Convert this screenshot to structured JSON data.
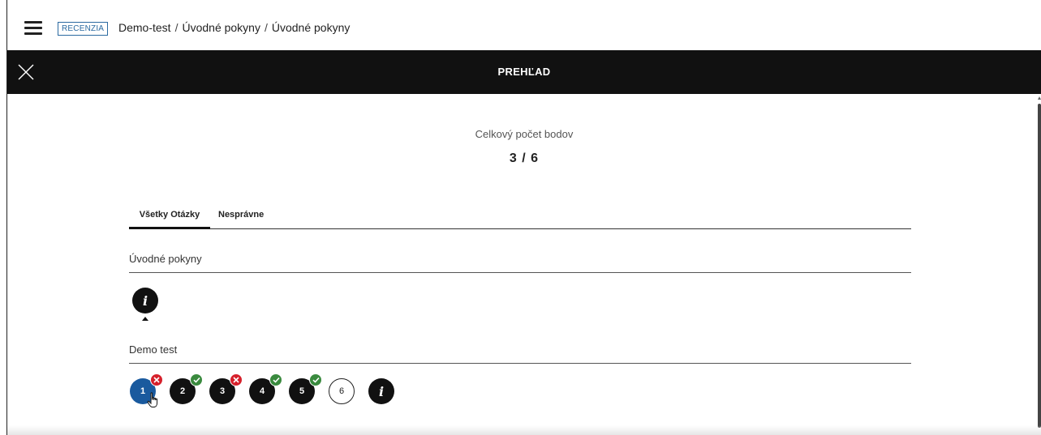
{
  "topbar": {
    "badge": "RECENZIA",
    "breadcrumb": [
      "Demo-test",
      "Úvodné pokyny",
      "Úvodné pokyny"
    ],
    "separator": "/"
  },
  "header": {
    "title": "PREHĽAD"
  },
  "score": {
    "label": "Celkový počet bodov",
    "value": "3 / 6"
  },
  "tabs": [
    {
      "label": "Všetky Otázky",
      "active": true
    },
    {
      "label": "Nesprávne",
      "active": false
    }
  ],
  "sections": [
    {
      "title": "Úvodné pokyny",
      "items": [
        {
          "type": "info",
          "label": "i"
        }
      ]
    },
    {
      "title": "Demo test",
      "items": [
        {
          "type": "question",
          "label": "1",
          "status": "wrong",
          "current": true
        },
        {
          "type": "question",
          "label": "2",
          "status": "correct"
        },
        {
          "type": "question",
          "label": "3",
          "status": "wrong"
        },
        {
          "type": "question",
          "label": "4",
          "status": "correct"
        },
        {
          "type": "question",
          "label": "5",
          "status": "correct"
        },
        {
          "type": "question",
          "label": "6",
          "status": "unanswered"
        },
        {
          "type": "info",
          "label": "i"
        }
      ]
    }
  ],
  "colors": {
    "accent": "#1a5a9e",
    "correct": "#3a8a3e",
    "wrong": "#d6202b",
    "header_bg": "#111111"
  }
}
